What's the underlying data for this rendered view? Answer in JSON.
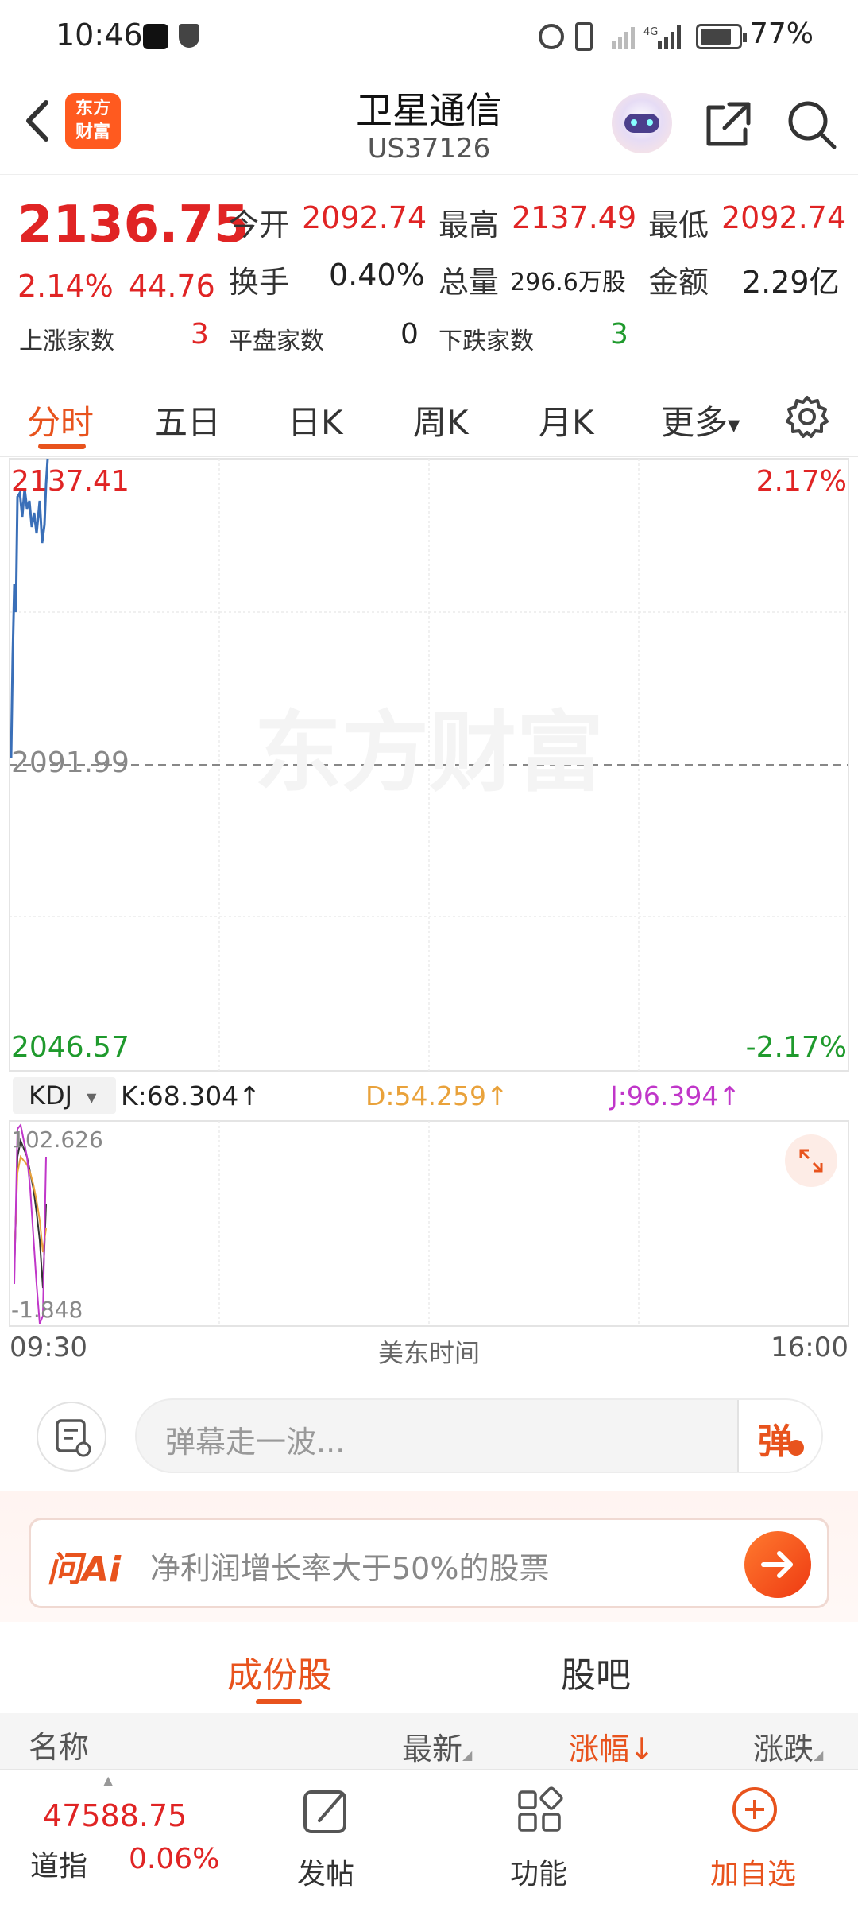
{
  "status_bar": {
    "time": "10:46",
    "battery": "77%"
  },
  "header": {
    "logo_text": "东方\n财富",
    "title": "卫星通信",
    "code": "US37126"
  },
  "quote": {
    "price": "2136.75",
    "change_pct": "2.14%",
    "change": "44.76",
    "open_label": "今开",
    "open": "2092.74",
    "high_label": "最高",
    "high": "2137.49",
    "low_label": "最低",
    "low": "2092.74",
    "turnover_label": "换手",
    "turnover": "0.40%",
    "volume_label": "总量",
    "volume": "296.6万股",
    "amount_label": "金额",
    "amount": "2.29亿",
    "up_label": "上涨家数",
    "up": "3",
    "flat_label": "平盘家数",
    "flat": "0",
    "down_label": "下跌家数",
    "down": "3"
  },
  "tabs": [
    "分时",
    "五日",
    "日K",
    "周K",
    "月K",
    "更多"
  ],
  "chart": {
    "top_price": "2137.41",
    "top_pct": "2.17%",
    "mid_price": "2091.99",
    "bottom_price": "2046.57",
    "bottom_pct": "-2.17%",
    "watermark": "东方财富",
    "kdj_select": "KDJ",
    "k": "K:68.304↑",
    "d": "D:54.259↑",
    "j": "J:96.394↑",
    "kdj_max": "102.626",
    "kdj_min": "-1.848",
    "time_start": "09:30",
    "time_mid": "美东时间",
    "time_end": "16:00",
    "colors": {
      "price": "#3a6fb8",
      "k": "#333333",
      "d": "#e9a23b",
      "j": "#c036c9"
    }
  },
  "comment": {
    "placeholder": "弹幕走一波...",
    "danmu_label": "弹"
  },
  "ai": {
    "logo": "问Ai",
    "prompt": "净利润增长率大于50%的股票"
  },
  "subtabs": [
    "成份股",
    "股吧"
  ],
  "table_head": {
    "name": "名称",
    "latest": "最新",
    "change_pct": "涨幅↓",
    "change": "涨跌"
  },
  "bottom": {
    "index_value": "47588.75",
    "index_name": "道指",
    "index_pct": "0.06%",
    "post": "发帖",
    "func": "功能",
    "add": "加自选"
  }
}
